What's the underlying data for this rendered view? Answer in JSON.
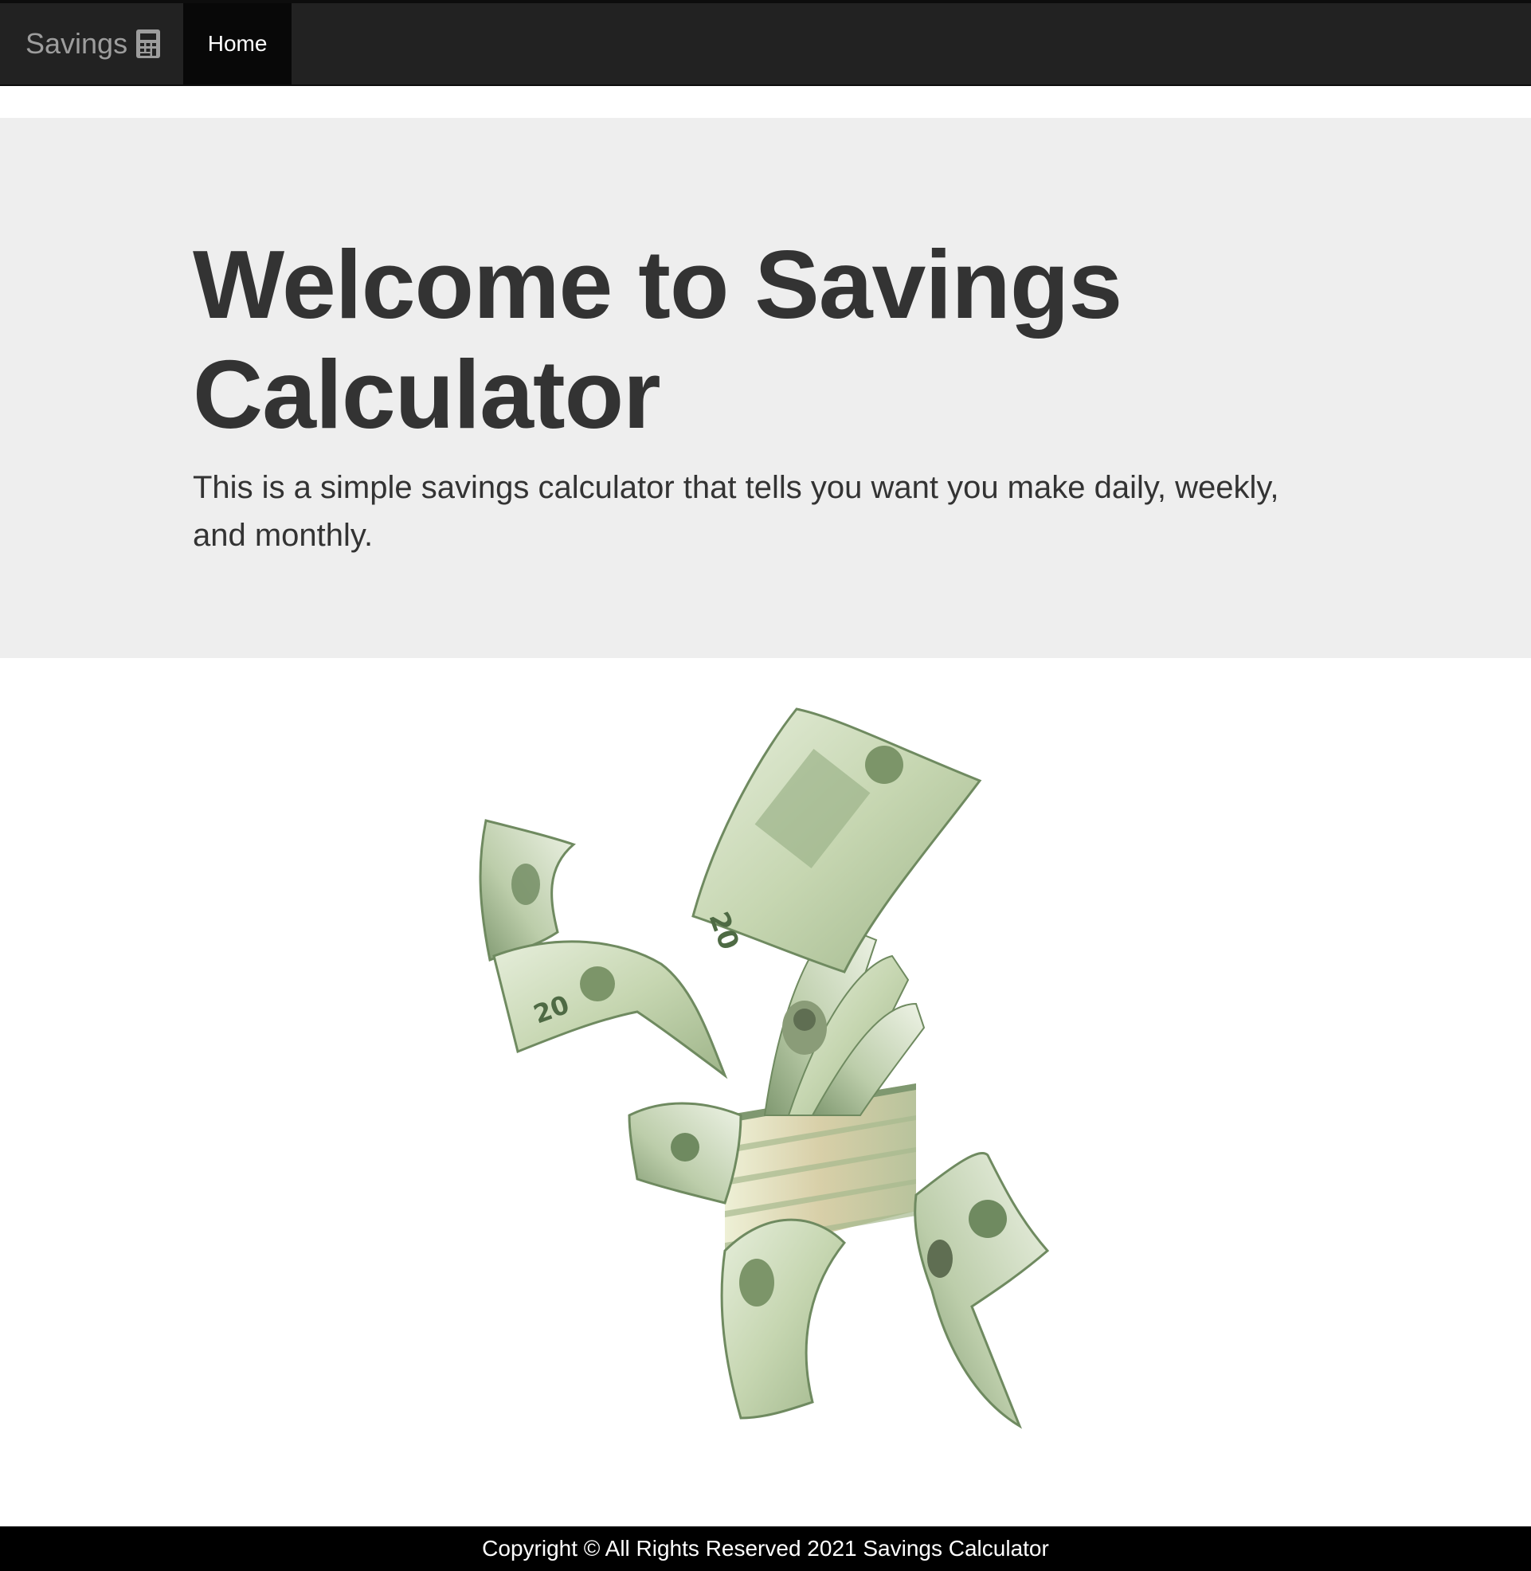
{
  "navbar": {
    "brand_label": "Savings",
    "brand_icon": "calculator-icon",
    "items": [
      {
        "label": "Home",
        "active": true
      }
    ]
  },
  "jumbotron": {
    "title": "Welcome to Savings Calculator",
    "description": "This is a simple savings calculator that tells you want you make daily, weekly, and monthly."
  },
  "hero_image": {
    "subject": "flying twenty dollar bills"
  },
  "footer": {
    "text": "Copyright © All Rights Reserved 2021 Savings Calculator"
  },
  "colors": {
    "navbar_bg": "#222222",
    "navbar_active_bg": "#080808",
    "brand_text": "#9d9d9d",
    "jumbotron_bg": "#eeeeee",
    "heading_text": "#333333",
    "footer_bg": "#000000",
    "bill_green": "#c8d8b4"
  }
}
